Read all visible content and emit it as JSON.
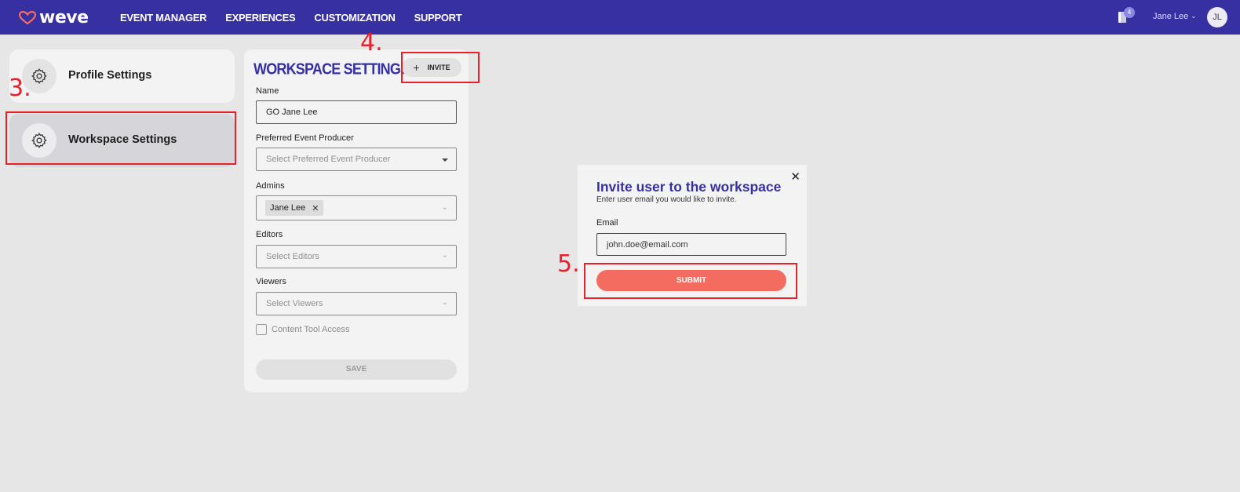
{
  "app": {
    "logo_text": "weve"
  },
  "nav": {
    "items": [
      "EVENT MANAGER",
      "EXPERIENCES",
      "CUSTOMIZATION",
      "SUPPORT"
    ]
  },
  "header": {
    "notification_count": "4",
    "user_name": "Jane Lee",
    "avatar_initials": "JL"
  },
  "sidebar": {
    "profile_label": "Profile Settings",
    "workspace_label": "Workspace Settings"
  },
  "workspace": {
    "title": "WORKSPACE SETTINGS",
    "invite_label": "INVITE",
    "name_label": "Name",
    "name_value": "GO Jane Lee",
    "producer_label": "Preferred Event Producer",
    "producer_placeholder": "Select Preferred Event Producer",
    "admins_label": "Admins",
    "admin_chip": "Jane Lee",
    "editors_label": "Editors",
    "editors_placeholder": "Select Editors",
    "viewers_label": "Viewers",
    "viewers_placeholder": "Select Viewers",
    "content_tool_label": "Content Tool Access",
    "save_label": "SAVE"
  },
  "modal": {
    "title": "Invite user to the workspace",
    "subtitle": "Enter user email you would like to invite.",
    "email_label": "Email",
    "email_value": "john.doe@email.com",
    "submit_label": "SUBMIT"
  },
  "annotations": {
    "step3": "3.",
    "step4": "4.",
    "step5": "5."
  },
  "colors": {
    "brand": "#3730a3",
    "submit": "#f46b60",
    "annotation": "#e8202a"
  }
}
